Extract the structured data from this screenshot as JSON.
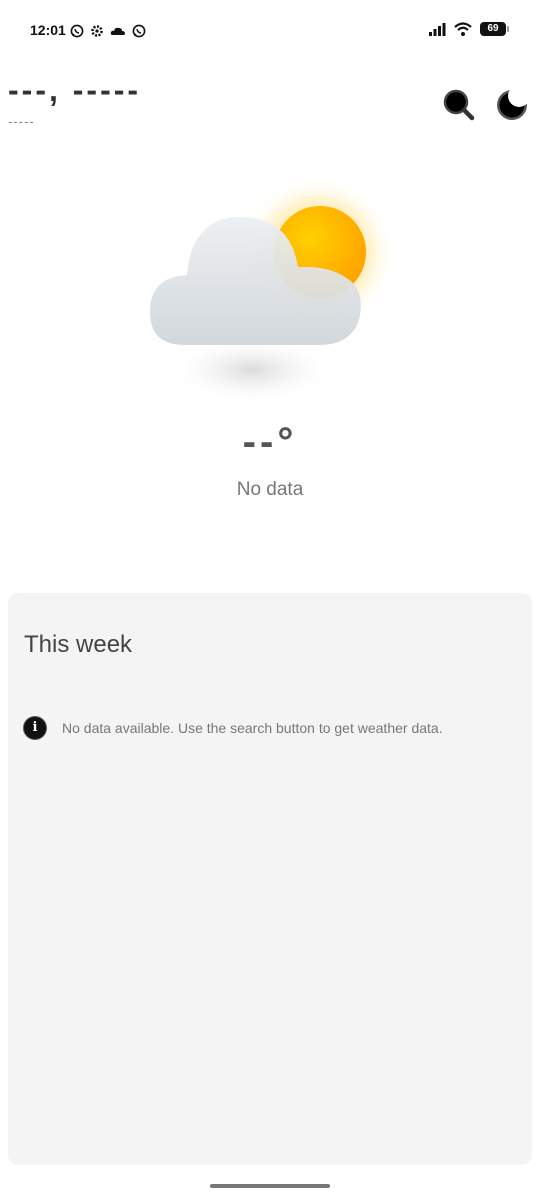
{
  "status_bar": {
    "time": "12:01",
    "battery": "69",
    "left_icons": [
      "whatsapp-icon",
      "settings-icon",
      "cloud-icon",
      "whatsapp-icon"
    ],
    "right_icons": [
      "signal-icon",
      "wifi-icon",
      "battery-icon"
    ]
  },
  "header": {
    "location": "---, -----",
    "subtitle": "-----",
    "search_icon": "search-icon",
    "theme_icon": "moon-icon"
  },
  "current": {
    "temperature": "--°",
    "condition": "No data",
    "illustration": "partly-cloudy-icon",
    "colors": {
      "sun": "#ffb300",
      "cloud": "#dde1e4"
    }
  },
  "week": {
    "title": "This week",
    "message": "No data available. Use the search button to get weather data.",
    "info_icon": "info-icon"
  }
}
